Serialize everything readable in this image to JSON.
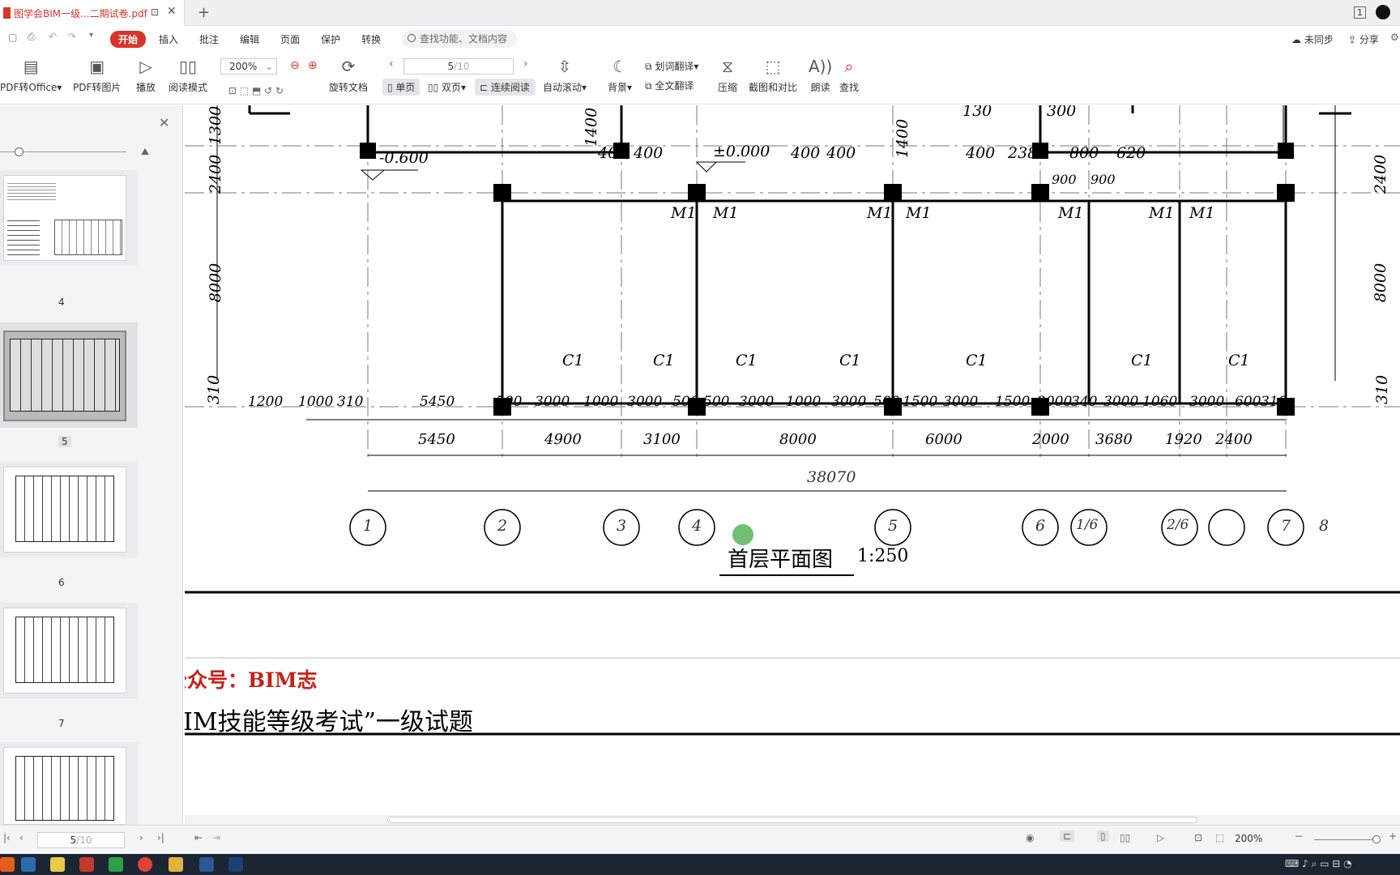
{
  "tab": {
    "title": "图学会BIM一级...二期试卷.pdf"
  },
  "menu": {
    "start": "开始",
    "items": [
      "插入",
      "批注",
      "编辑",
      "页面",
      "保护",
      "转换"
    ],
    "search_placeholder": "查找功能、文档内容",
    "sync": "未同步",
    "share": "分享"
  },
  "toolbar": {
    "pdf_to_office": "PDF转Office",
    "pdf_to_image": "PDF转图片",
    "play": "播放",
    "read_mode": "阅读模式",
    "zoom": "200%",
    "rotate": "旋转文档",
    "page_current": "5",
    "page_total": "/10",
    "single": "单页",
    "double": "双页",
    "continuous": "连续阅读",
    "auto_scroll": "自动滚动",
    "background": "背景",
    "word_translate": "划词翻译",
    "full_translate": "全文翻译",
    "compress": "压缩",
    "screenshot_compare": "截图和对比",
    "read_aloud": "朗读",
    "find": "查找"
  },
  "sidebar": {
    "pages": [
      "4",
      "5",
      "6",
      "7"
    ]
  },
  "drawing": {
    "title": "首层平面图",
    "scale": "1:250",
    "top_dims": [
      "400",
      "400",
      "400",
      "400",
      "400",
      "2380",
      "800",
      "620",
      "900",
      "900"
    ],
    "elevations": [
      "-0.600",
      "±0.000"
    ],
    "left_dims": [
      "1300",
      "2400",
      "8000",
      "310",
      "1400",
      "1400"
    ],
    "right_dims": [
      "2400",
      "8000",
      "310"
    ],
    "top_misc": [
      "130",
      "300"
    ],
    "doors": [
      "M1",
      "M1",
      "M1",
      "M1",
      "M1",
      "M1",
      "M1"
    ],
    "windows": [
      "C1",
      "C1",
      "C1",
      "C1",
      "C1",
      "C1",
      "C1"
    ],
    "row1": [
      "1200",
      "1000",
      "310",
      "5450",
      "500",
      "3000",
      "1000",
      "3000",
      "500",
      "500",
      "3000",
      "1000",
      "3000",
      "500",
      "1500",
      "3000",
      "1500",
      "2000",
      "340",
      "3000",
      "1060",
      "3000",
      "600",
      "310"
    ],
    "row2": [
      "5450",
      "4900",
      "3100",
      "8000",
      "6000",
      "2000",
      "3680",
      "1920",
      "2400"
    ],
    "total": "38070",
    "axes": [
      "1",
      "2",
      "3",
      "4",
      "5",
      "6",
      "1/6",
      "2/6",
      "7",
      "8"
    ]
  },
  "footer_text": {
    "wechat": "公众号：BIM志",
    "exam": "IM技能等级考试”一级试题"
  },
  "statusbar": {
    "page_current": "5",
    "page_total": "/10",
    "zoom": "200%"
  }
}
